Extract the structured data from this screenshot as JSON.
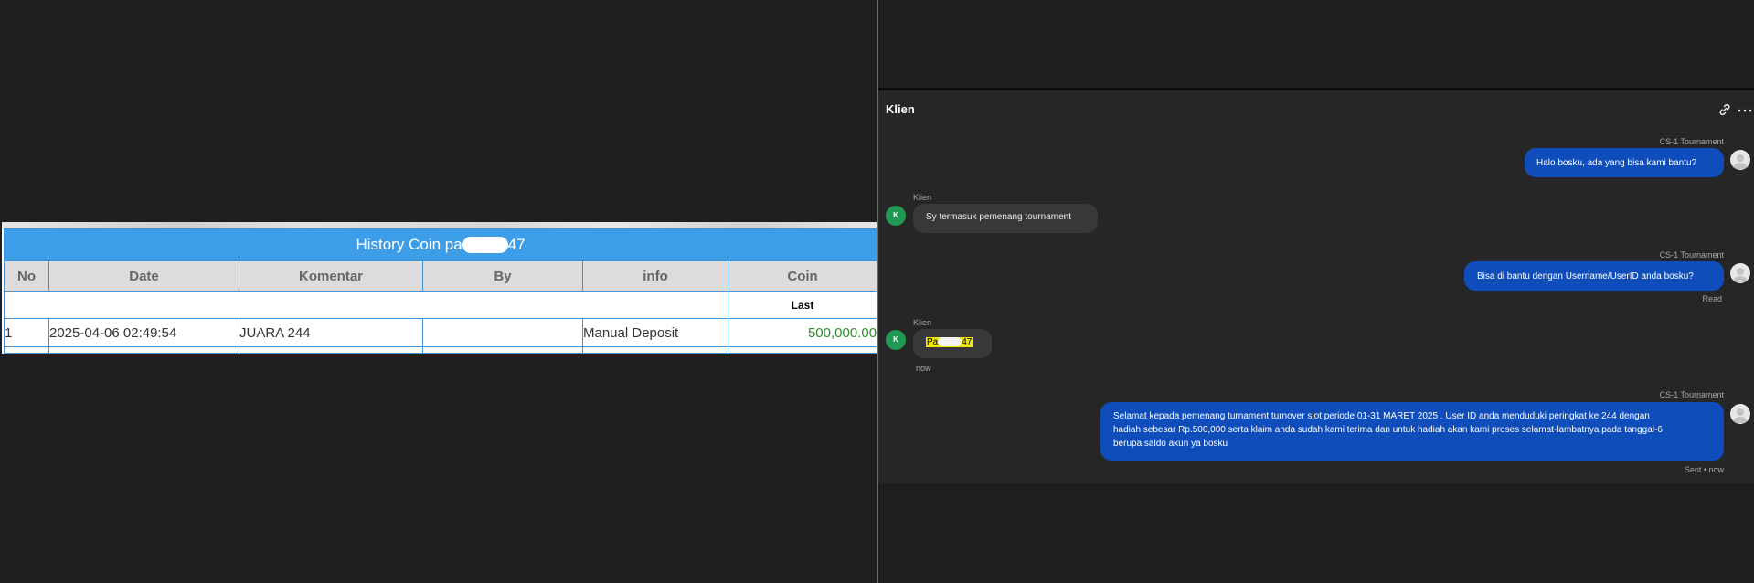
{
  "history": {
    "title_prefix": "History Coin pa",
    "title_suffix": "47",
    "columns": [
      "No",
      "Date",
      "Komentar",
      "By",
      "info",
      "Coin"
    ],
    "subheader_last": "Last",
    "rows": [
      {
        "no": "1",
        "date": "2025-04-06 02:49:54",
        "komentar": "JUARA 244",
        "by": "",
        "info": "Manual Deposit",
        "coin": "500,000.00"
      }
    ]
  },
  "chat": {
    "title": "Klien",
    "messages": [
      {
        "direction": "out",
        "sender": "CS-1 Tournament",
        "text": "Halo bosku, ada yang bisa kami bantu?"
      },
      {
        "direction": "in",
        "sender": "Klien",
        "avatar_initial": "K",
        "text": "Sy termasuk pemenang tournament"
      },
      {
        "direction": "out",
        "sender": "CS-1 Tournament",
        "text": "Bisa di bantu dengan Username/UserID anda bosku?",
        "status": "Read"
      },
      {
        "direction": "in",
        "sender": "Klien",
        "avatar_initial": "K",
        "text_prefix": "Pa",
        "text_suffix": "47",
        "time": "now"
      },
      {
        "direction": "out",
        "sender": "CS-1 Tournament",
        "lines": [
          "Selamat kepada pemenang turnament turnover slot periode 01-31 MARET 2025 . User ID anda menduduki peringkat ke 244 dengan",
          "hadiah sebesar Rp.500,000 serta klaim anda sudah kami terima dan untuk hadiah akan kami proses selamat-lambatnya pada tanggal-6",
          "berupa saldo akun ya bosku"
        ],
        "status": "Sent • now"
      }
    ]
  },
  "icons": {
    "link": "link-icon",
    "more": "more-horizontal-icon",
    "avatar_agent": "user-avatar-icon"
  },
  "colors": {
    "table_title_bg": "#3d9de7",
    "coin_green": "#2f8a2f",
    "bubble_out": "#0f4dbb",
    "bubble_in": "#38383a",
    "avatar_green": "#1f9a53",
    "highlight": "#f0e800"
  }
}
